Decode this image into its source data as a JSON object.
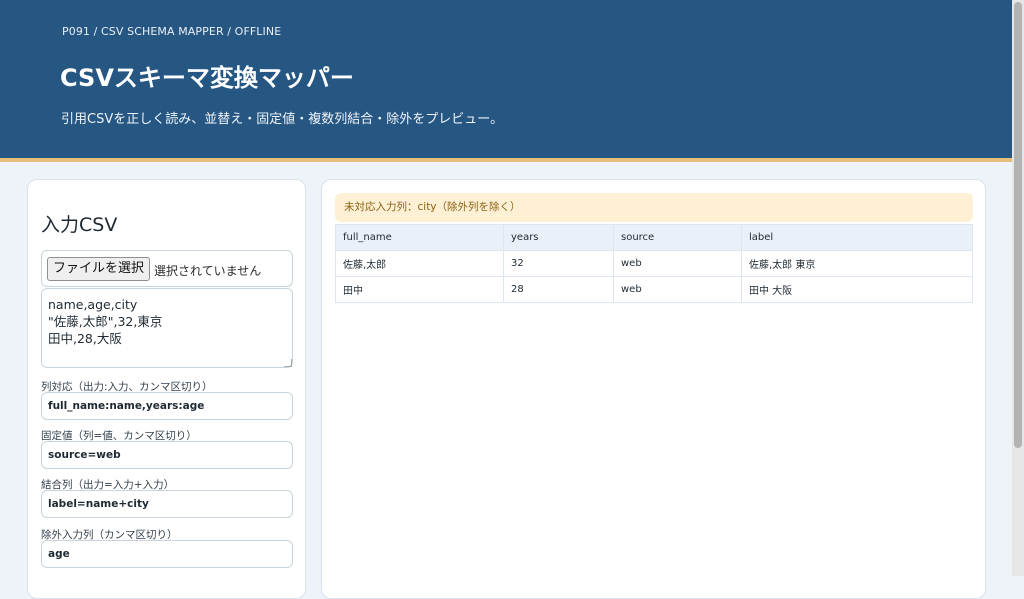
{
  "header": {
    "breadcrumb": "P091 / CSV SCHEMA MAPPER / OFFLINE",
    "title": "CSVスキーマ変換マッパー",
    "subtitle": "引用CSVを正しく読み、並替え・固定値・複数列結合・除外をプレビュー。",
    "bg_color": "#265783",
    "accent_color": "#e6c07a"
  },
  "input_panel": {
    "title": "入力CSV",
    "file_button_label": "ファイルを選択",
    "file_status": "選択されていません",
    "csv_text": "name,age,city\n\"佐藤,太郎\",32,東京\n田中,28,大阪",
    "fields": [
      {
        "label": "列対応（出力:入力、カンマ区切り）",
        "value": "full_name:name,years:age"
      },
      {
        "label": "固定値（列=値、カンマ区切り）",
        "value": "source=web"
      },
      {
        "label": "結合列（出力=入力+入力）",
        "value": "label=name+city"
      },
      {
        "label": "除外入力列（カンマ区切り）",
        "value": "age"
      }
    ]
  },
  "preview_panel": {
    "warning": "未対応入力列：city（除外列を除く）",
    "warning_bg": "#fdf0d5",
    "columns": [
      "full_name",
      "years",
      "source",
      "label"
    ],
    "rows": [
      [
        "佐藤,太郎",
        "32",
        "web",
        "佐藤,太郎 東京"
      ],
      [
        "田中",
        "28",
        "web",
        "田中 大阪"
      ]
    ]
  }
}
